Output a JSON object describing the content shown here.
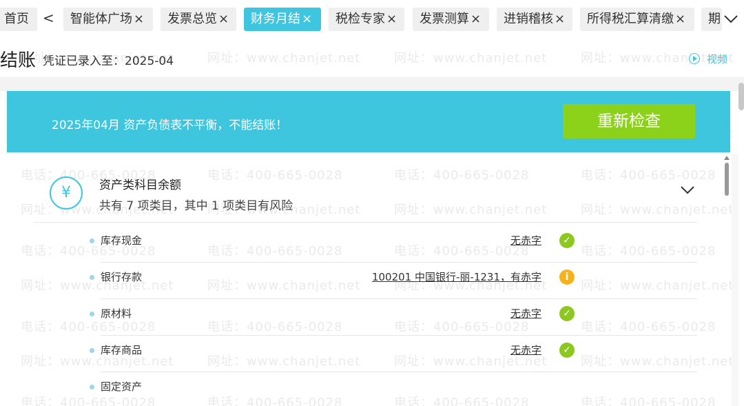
{
  "tabs": {
    "home": "首页",
    "items": [
      {
        "label": "智能体广场",
        "close": "×"
      },
      {
        "label": "发票总览",
        "close": "×"
      },
      {
        "label": "财务月结",
        "close": "×"
      },
      {
        "label": "税检专家",
        "close": "×"
      },
      {
        "label": "发票测算",
        "close": "×"
      },
      {
        "label": "进销稽核",
        "close": "×"
      },
      {
        "label": "所得税汇算清缴",
        "close": "×"
      },
      {
        "label": "期",
        "close": ""
      }
    ],
    "active_index": 2,
    "nav_left": "<"
  },
  "header": {
    "title": "结账",
    "voucher_status": "凭证已录入至：2025-04",
    "video_link": "视频"
  },
  "banner": {
    "message": "2025年04月 资产负债表不平衡，不能结账！",
    "recheck_button": "重新检查",
    "bg_color": "#3ec6de",
    "button_color": "#8cd21a"
  },
  "section": {
    "icon_glyph": "¥",
    "title": "资产类科目余额",
    "subtitle": "共有 7 项类目，其中 1 项类目有风险"
  },
  "rows": [
    {
      "name": "库存现金",
      "result": "无赤字",
      "status": "ok"
    },
    {
      "name": "银行存款",
      "result": "100201 中国银行-丽-1231，有赤字",
      "status": "warn"
    },
    {
      "name": "原材料",
      "result": "无赤字",
      "status": "ok"
    },
    {
      "name": "库存商品",
      "result": "无赤字",
      "status": "ok"
    },
    {
      "name": "固定资产",
      "result": "",
      "status": ""
    }
  ],
  "status_glyphs": {
    "ok": "✓",
    "warn": "i"
  },
  "watermark": {
    "phone": "电话：400-665-0028",
    "site": "网址：www.chanjet.net"
  }
}
